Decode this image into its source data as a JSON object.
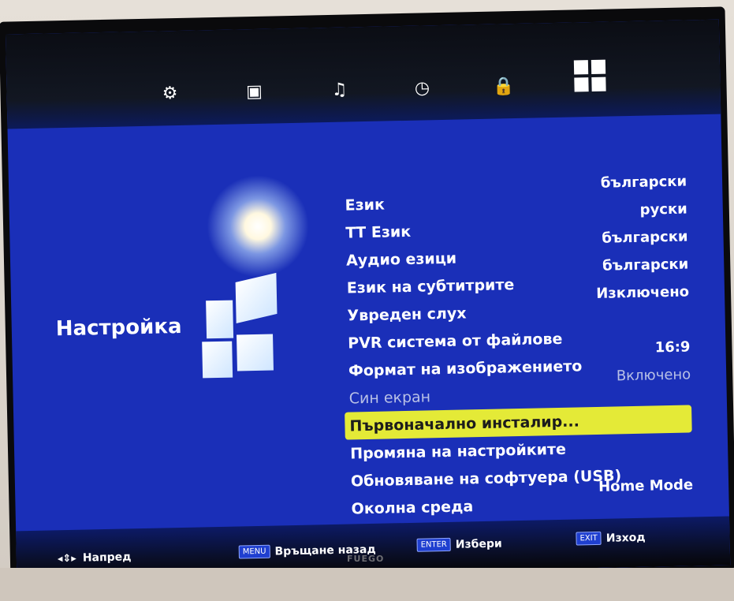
{
  "tabs": [
    {
      "icon": "gear-icon",
      "glyph": "⚙"
    },
    {
      "icon": "monitor-icon",
      "glyph": "▣"
    },
    {
      "icon": "music-note-icon",
      "glyph": "♫"
    },
    {
      "icon": "clock-icon",
      "glyph": "◷"
    },
    {
      "icon": "lock-icon",
      "glyph": "🔒"
    },
    {
      "icon": "grid-settings-icon",
      "glyph": ""
    }
  ],
  "section": {
    "title": "Настройка"
  },
  "menu": {
    "items": [
      {
        "label": "Език",
        "value": "български"
      },
      {
        "label": "ТТ Език",
        "value": "руски"
      },
      {
        "label": "Аудио езици",
        "value": "български"
      },
      {
        "label": "Език на субтитрите",
        "value": "български"
      },
      {
        "label": "Увреден слух",
        "value": "Изключено"
      },
      {
        "label": "PVR система от файлове",
        "value": ""
      },
      {
        "label": "Формат на изображението",
        "value": "16:9"
      },
      {
        "label": "Син екран",
        "value": "Включено"
      },
      {
        "label": "Първоначално инсталир...",
        "value": ""
      },
      {
        "label": "Промяна на настройките",
        "value": ""
      },
      {
        "label": "Обновяване на софтуера (USB)",
        "value": ""
      },
      {
        "label": "Околна среда",
        "value": "Home Mode"
      }
    ]
  },
  "footer": {
    "next": {
      "icon": "arrows-icon",
      "label": "Напред"
    },
    "back": {
      "key": "MENU",
      "label": "Връщане назад"
    },
    "select": {
      "key": "ENTER",
      "label": "Избери"
    },
    "exit": {
      "key": "EXIT",
      "label": "Изход"
    }
  },
  "brand": "FUEGO",
  "colors": {
    "screen": "#1a2fb8",
    "highlight": "#e4ea37"
  }
}
